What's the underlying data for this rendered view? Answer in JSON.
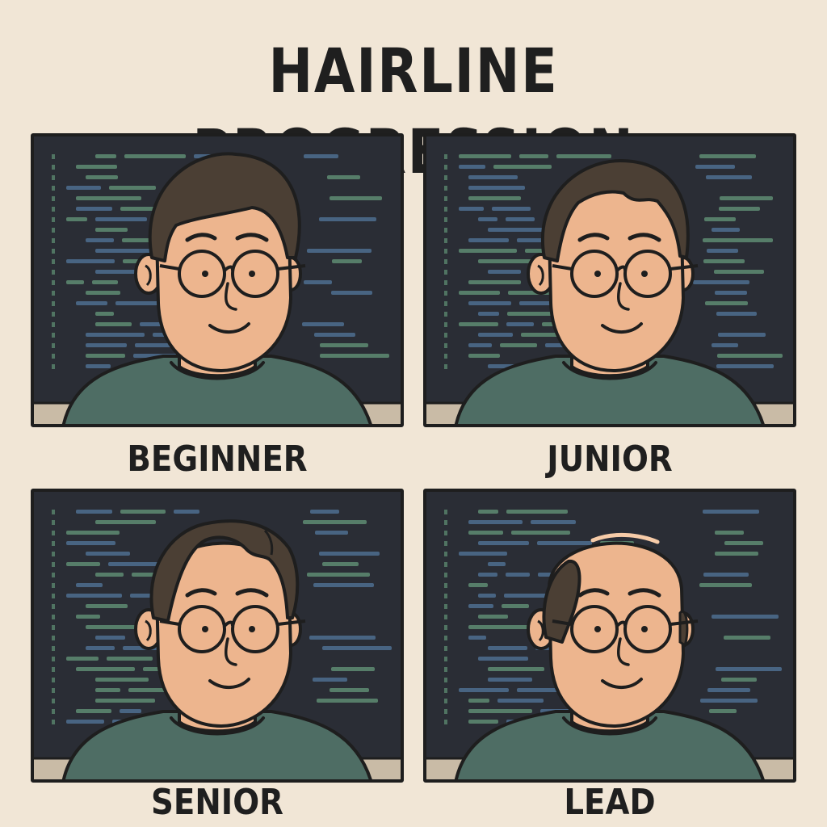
{
  "title": "HAIRLINE PROGRESSION",
  "panels": [
    {
      "label": "BEGINNER",
      "hair_stage": 0
    },
    {
      "label": "JUNIOR",
      "hair_stage": 1
    },
    {
      "label": "SENIOR",
      "hair_stage": 2
    },
    {
      "label": "LEAD",
      "hair_stage": 3
    }
  ],
  "colors": {
    "background": "#F1E6D6",
    "screen": "#2A2D35",
    "code_green": "#5E8C72",
    "code_blue": "#4E6E8F",
    "desk": "#C9BBA6",
    "skin": "#EDB58E",
    "hair": "#4B3F34",
    "shirt": "#4E6D64",
    "outline": "#1E1E1E"
  }
}
